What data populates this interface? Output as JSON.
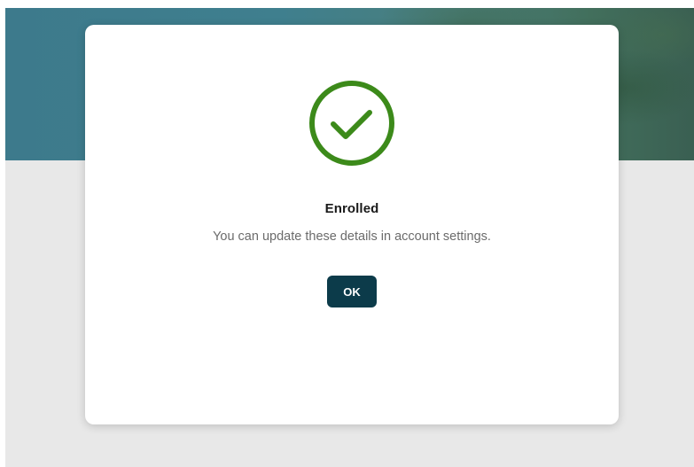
{
  "dialog": {
    "title": "Enrolled",
    "message": "You can update these details in account settings.",
    "ok_label": "OK",
    "icon": "check-circle-icon",
    "icon_color": "#3c8a1a"
  },
  "colors": {
    "button_bg": "#0c3b4a",
    "backdrop": "#e8e8e8"
  }
}
